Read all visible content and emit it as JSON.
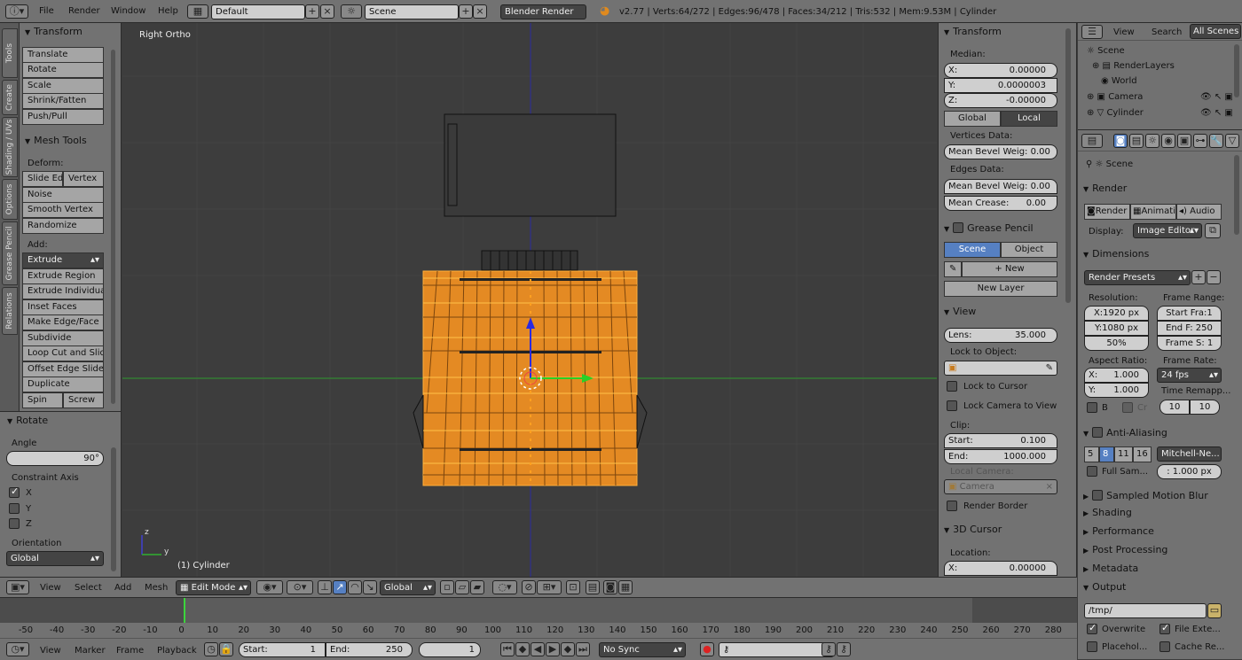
{
  "menubar": {
    "info_icon": "info-icon",
    "file": "File",
    "render": "Render",
    "window": "Window",
    "help": "Help",
    "layout": "Default",
    "scene": "Scene",
    "engine": "Blender Render",
    "stats": "v2.77 | Verts:64/272 | Edges:96/478 | Faces:34/212 | Tris:532 | Mem:9.53M | Cylinder"
  },
  "lefttabs": [
    "Tools",
    "Create",
    "Shading / UVs",
    "Options",
    "Grease Pencil",
    "Relations"
  ],
  "toolshelf": {
    "transform_title": "Transform",
    "transform_buttons": [
      "Translate",
      "Rotate",
      "Scale",
      "Shrink/Fatten",
      "Push/Pull"
    ],
    "meshtools_title": "Mesh Tools",
    "deform_label": "Deform:",
    "slide_edge": "Slide Ed",
    "vertex": "Vertex",
    "noise": "Noise",
    "smooth_vertex": "Smooth Vertex",
    "randomize": "Randomize",
    "add_label": "Add:",
    "extrude": "Extrude",
    "add_buttons": [
      "Extrude Region",
      "Extrude Individual",
      "Inset Faces",
      "Make Edge/Face",
      "Subdivide",
      "Loop Cut and Slide",
      "Offset Edge Slide",
      "Duplicate"
    ],
    "spin": "Spin",
    "screw": "Screw"
  },
  "operator": {
    "title": "Rotate",
    "angle_label": "Angle",
    "angle_value": "90°",
    "constraint_label": "Constraint Axis",
    "axes": [
      "X",
      "Y",
      "Z"
    ],
    "orientation_label": "Orientation",
    "orientation_value": "Global"
  },
  "viewport": {
    "view_name": "Right Ortho",
    "object_label": "(1) Cylinder",
    "axis_z": "z",
    "axis_y": "y"
  },
  "npanel": {
    "transform_title": "Transform",
    "median_label": "Median:",
    "x_label": "X:",
    "x_value": "0.00000",
    "y_label": "Y:",
    "y_value": "0.0000003",
    "z_label": "Z:",
    "z_value": "-0.00000",
    "global": "Global",
    "local": "Local",
    "vertices_data": "Vertices Data:",
    "mean_bevel_weight_v": "Mean Bevel Weig: 0.00",
    "edges_data": "Edges Data:",
    "mean_bevel_weight_e": "Mean Bevel Weig: 0.00",
    "mean_crease_label": "Mean Crease:",
    "mean_crease_value": "0.00",
    "grease_title": "Grease Pencil",
    "scene": "Scene",
    "object": "Object",
    "new": "New",
    "new_layer": "New Layer",
    "view_title": "View",
    "lens_label": "Lens:",
    "lens_value": "35.000",
    "lock_object": "Lock to Object:",
    "lock_cursor": "Lock to Cursor",
    "lock_camera": "Lock Camera to View",
    "clip_label": "Clip:",
    "start_label": "Start:",
    "start_value": "0.100",
    "end_label": "End:",
    "end_value": "1000.000",
    "local_camera": "Local Camera:",
    "camera": "Camera",
    "render_border": "Render Border",
    "cursor_title": "3D Cursor",
    "location_label": "Location:",
    "loc_x_label": "X:",
    "loc_x_value": "0.00000"
  },
  "outliner": {
    "view": "View",
    "search": "Search",
    "scenes": "All Scenes",
    "items": [
      "Scene",
      "RenderLayers",
      "World",
      "Camera",
      "Cylinder"
    ]
  },
  "props": {
    "scene": "Scene",
    "render_title": "Render",
    "render_btn": "Render",
    "anim_btn": "Animati",
    "audio_btn": "Audio",
    "display_label": "Display:",
    "display_value": "Image Editor",
    "dimensions_title": "Dimensions",
    "presets": "Render Presets",
    "resolution_label": "Resolution:",
    "frame_range_label": "Frame Range:",
    "res_x": "X:1920 px",
    "res_y": "Y:1080 px",
    "res_pct": "50%",
    "start_frame": "Start Fra:1",
    "end_frame": "End F: 250",
    "frame_step": "Frame S: 1",
    "aspect_label": "Aspect Ratio:",
    "frame_rate_label": "Frame Rate:",
    "asp_x_label": "X:",
    "asp_x": "1.000",
    "asp_y_label": "Y:",
    "asp_y": "1.000",
    "fps": "24 fps",
    "time_remap": "Time Remapp...",
    "b": "B",
    "cr": "Cr",
    "remap_old": "10",
    "remap_new": "10",
    "aa_title": "Anti-Aliasing",
    "aa_samples": [
      "5",
      "8",
      "11",
      "16"
    ],
    "aa_filter": "Mitchell-Ne...",
    "full_sample": "Full Sam...",
    "filter_size": ": 1.000 px",
    "motion_blur": "Sampled Motion Blur",
    "shading": "Shading",
    "performance": "Performance",
    "post_processing": "Post Processing",
    "metadata": "Metadata",
    "output": "Output",
    "output_path": "/tmp/",
    "overwrite": "Overwrite",
    "file_ext": "File Exte...",
    "placeholders": "Placehol...",
    "cache_result": "Cache Re..."
  },
  "viewheader": {
    "view": "View",
    "select": "Select",
    "add": "Add",
    "mesh": "Mesh",
    "mode": "Edit Mode",
    "orientation": "Global"
  },
  "timeline": {
    "ticks": [
      "-50",
      "-40",
      "-30",
      "-20",
      "-10",
      "0",
      "10",
      "20",
      "30",
      "40",
      "50",
      "60",
      "70",
      "80",
      "90",
      "100",
      "110",
      "120",
      "130",
      "140",
      "150",
      "160",
      "170",
      "180",
      "190",
      "200",
      "210",
      "220",
      "230",
      "240",
      "250",
      "260",
      "270",
      "280"
    ],
    "view": "View",
    "marker": "Marker",
    "frame": "Frame",
    "playback": "Playback",
    "start_label": "Start:",
    "start_value": "1",
    "end_label": "End:",
    "end_value": "250",
    "current": "1",
    "sync": "No Sync"
  }
}
